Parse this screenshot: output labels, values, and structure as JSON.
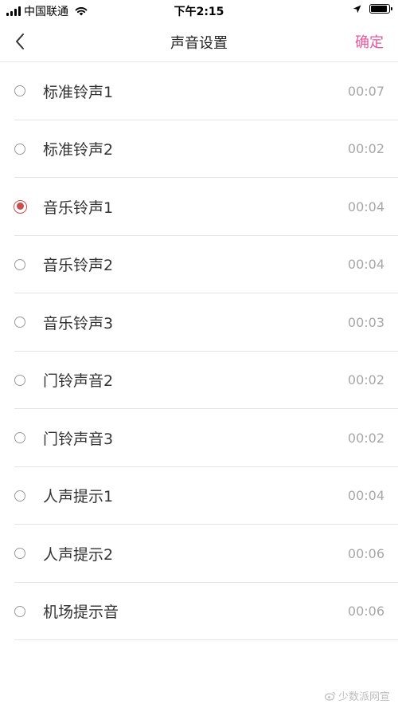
{
  "status_bar": {
    "carrier": "中国联通",
    "time": "下午2:15",
    "signal_icon": "signal-bars-icon",
    "wifi_icon": "wifi-icon",
    "location_icon": "location-arrow-icon",
    "battery_icon": "battery-icon",
    "battery_level": 0.9
  },
  "nav": {
    "back_icon": "chevron-left-icon",
    "title": "声音设置",
    "confirm_label": "确定",
    "confirm_color": "#e8569b"
  },
  "ringtones": [
    {
      "label": "标准铃声1",
      "duration": "00:07",
      "selected": false
    },
    {
      "label": "标准铃声2",
      "duration": "00:02",
      "selected": false
    },
    {
      "label": "音乐铃声1",
      "duration": "00:04",
      "selected": true
    },
    {
      "label": "音乐铃声2",
      "duration": "00:04",
      "selected": false
    },
    {
      "label": "音乐铃声3",
      "duration": "00:03",
      "selected": false
    },
    {
      "label": "门铃声音2",
      "duration": "00:02",
      "selected": false
    },
    {
      "label": "门铃声音3",
      "duration": "00:02",
      "selected": false
    },
    {
      "label": "人声提示1",
      "duration": "00:04",
      "selected": false
    },
    {
      "label": "人声提示2",
      "duration": "00:06",
      "selected": false
    },
    {
      "label": "机场提示音",
      "duration": "00:06",
      "selected": false
    }
  ],
  "colors": {
    "selected_radio": "#c94e4e",
    "duration_text": "#a8a8a8",
    "divider": "#e4e4e4"
  },
  "watermark": {
    "text": "少数派网宣",
    "icon": "weibo-icon"
  }
}
